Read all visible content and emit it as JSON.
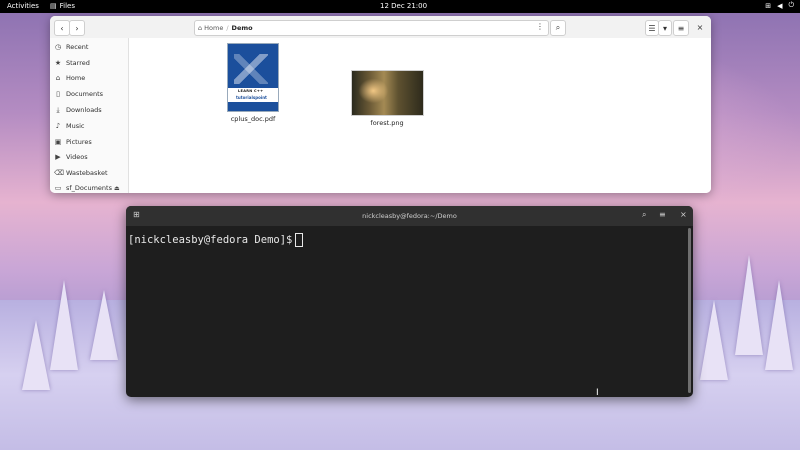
{
  "topbar": {
    "activities": "Activities",
    "app_name": "Files",
    "clock": "12 Dec  21:00"
  },
  "files_window": {
    "path": [
      "Home",
      "Demo"
    ],
    "sidebar": [
      {
        "label": "Recent",
        "icon": "clock-icon"
      },
      {
        "label": "Starred",
        "icon": "star-icon"
      },
      {
        "label": "Home",
        "icon": "home-icon"
      },
      {
        "label": "Documents",
        "icon": "document-icon"
      },
      {
        "label": "Downloads",
        "icon": "download-icon"
      },
      {
        "label": "Music",
        "icon": "music-icon"
      },
      {
        "label": "Pictures",
        "icon": "picture-icon"
      },
      {
        "label": "Videos",
        "icon": "video-icon"
      },
      {
        "label": "Wastebasket",
        "icon": "trash-icon"
      },
      {
        "label": "sf_Documents",
        "icon": "drive-icon"
      }
    ],
    "files": [
      {
        "name": "cplus_doc.pdf",
        "type": "pdf",
        "thumb_text_1": "LEARN C++",
        "thumb_text_2": "tutorialspoint"
      },
      {
        "name": "forest.png",
        "type": "image"
      }
    ]
  },
  "terminal": {
    "title": "nickcleasby@fedora:~/Demo",
    "prompt": "[nickcleasby@fedora Demo]$"
  }
}
